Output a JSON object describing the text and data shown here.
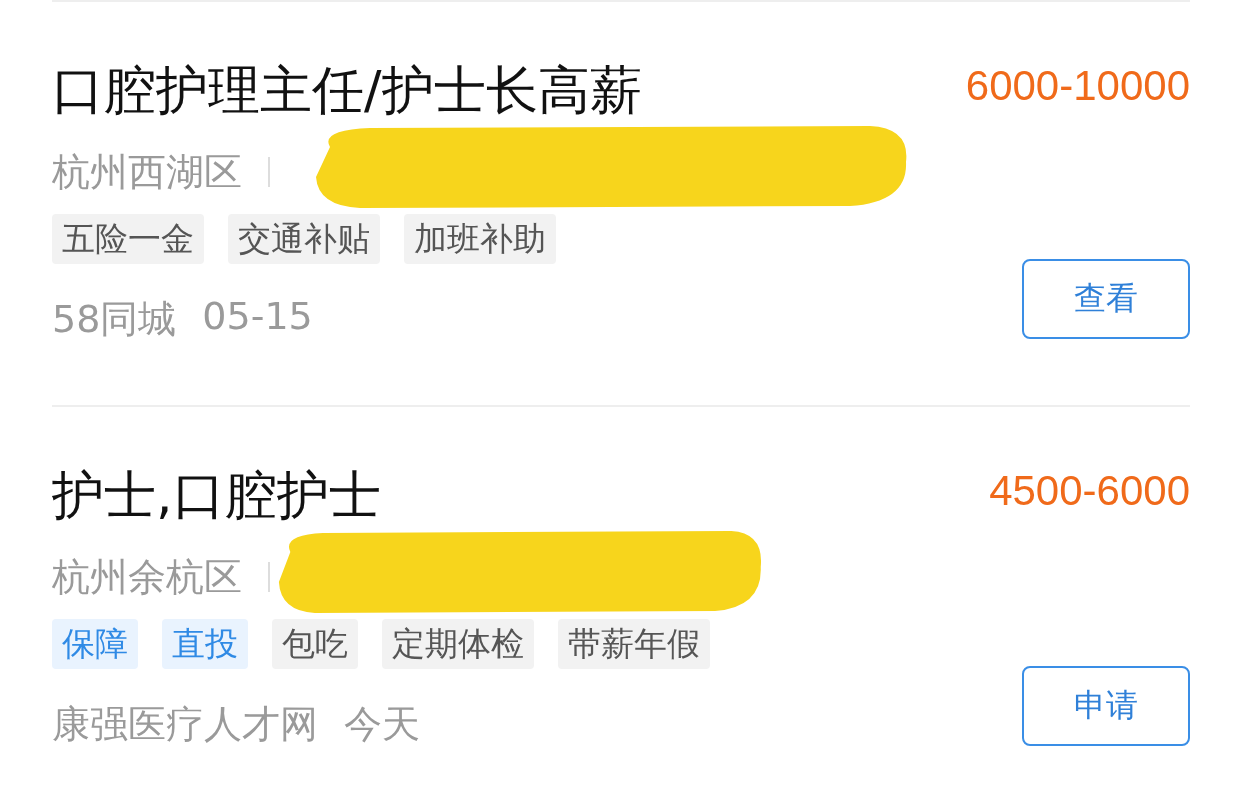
{
  "jobs": [
    {
      "title": "口腔护理主任/护士长高薪",
      "salary": "6000-10000",
      "location": "杭州西湖区",
      "tags": [
        {
          "label": "五险一金",
          "kind": "plain"
        },
        {
          "label": "交通补贴",
          "kind": "plain"
        },
        {
          "label": "加班补助",
          "kind": "plain"
        }
      ],
      "source": "58同城",
      "date": "05-15",
      "action": "查看"
    },
    {
      "title": "护士,口腔护士",
      "salary": "4500-6000",
      "location": "杭州余杭区",
      "tags": [
        {
          "label": "保障",
          "kind": "highlight"
        },
        {
          "label": "直投",
          "kind": "highlight"
        },
        {
          "label": "包吃",
          "kind": "plain"
        },
        {
          "label": "定期体检",
          "kind": "plain"
        },
        {
          "label": "带薪年假",
          "kind": "plain"
        }
      ],
      "source": "康强医疗人才网",
      "date": "今天",
      "action": "申请"
    }
  ]
}
